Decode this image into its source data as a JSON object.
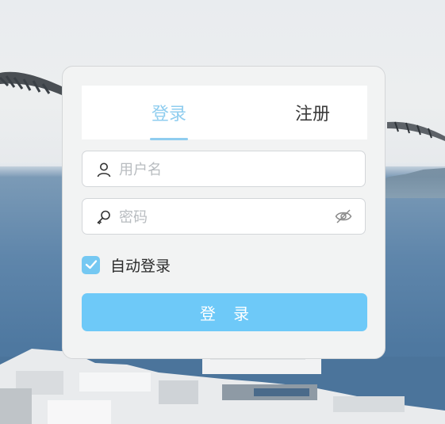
{
  "tabs": [
    {
      "label": "登录",
      "active": true
    },
    {
      "label": "注册",
      "active": false
    }
  ],
  "username": {
    "placeholder": "用户名",
    "value": ""
  },
  "password": {
    "placeholder": "密码",
    "value": ""
  },
  "remember": {
    "label": "自动登录",
    "checked": true
  },
  "submit": {
    "label": "登 录"
  },
  "colors": {
    "accent": "#6ec9f8",
    "tab_active": "#8fcdef",
    "card": "#f2f3f3"
  },
  "icons": {
    "username": "user-icon",
    "password": "key-icon",
    "toggle": "eye-off-icon",
    "check": "checkmark-icon"
  }
}
